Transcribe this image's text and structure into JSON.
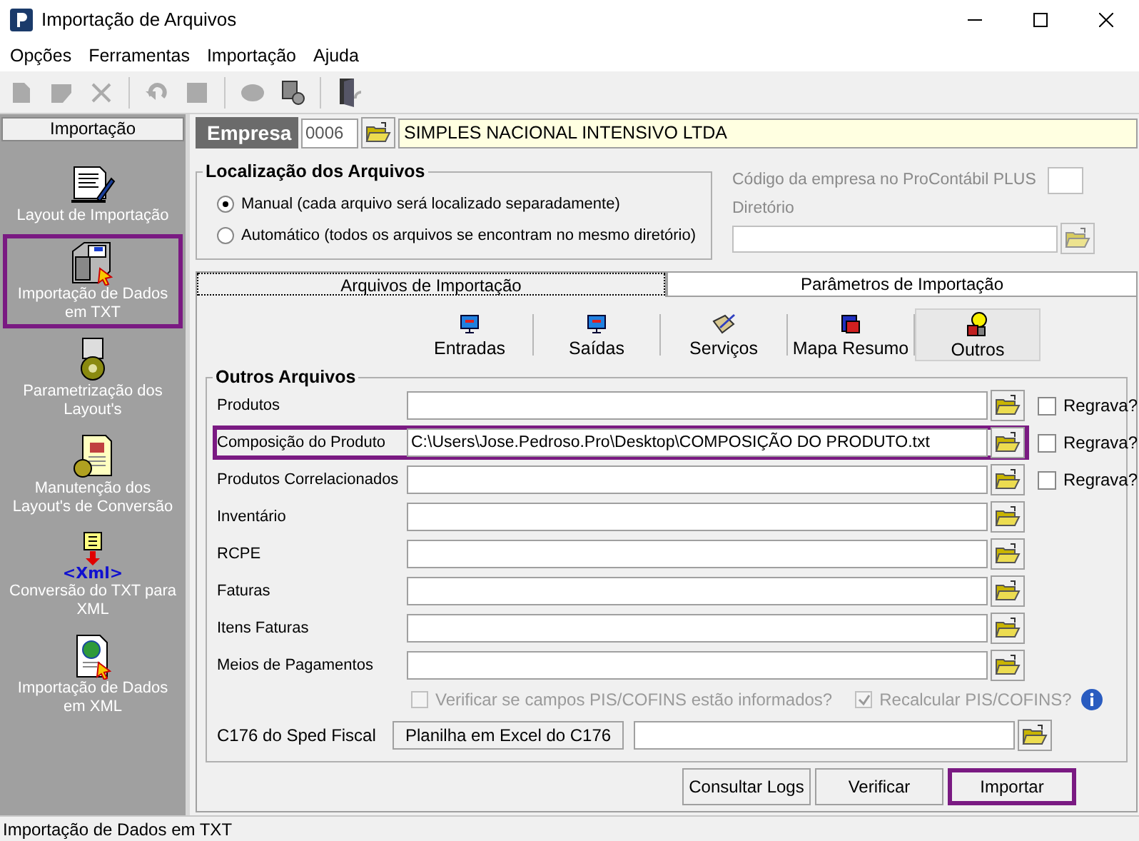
{
  "window": {
    "title": "Importação de Arquivos"
  },
  "menu": [
    "Opções",
    "Ferramentas",
    "Importação",
    "Ajuda"
  ],
  "sidebar": {
    "title": "Importação",
    "items": [
      {
        "label": "Layout de Importação",
        "highlighted": false
      },
      {
        "label": "Importação de Dados em TXT",
        "highlighted": true
      },
      {
        "label": "Parametrização dos Layout's",
        "highlighted": false
      },
      {
        "label": "Manutenção dos Layout's de Conversão",
        "highlighted": false
      },
      {
        "label": "Conversão do TXT para XML",
        "icon_text": "<Xml>",
        "highlighted": false
      },
      {
        "label": "Importação de Dados em XML",
        "highlighted": false
      }
    ]
  },
  "empresa": {
    "label": "Empresa",
    "code": "0006",
    "name": "SIMPLES NACIONAL INTENSIVO LTDA"
  },
  "localizacao": {
    "title": "Localização dos Arquivos",
    "options": [
      {
        "label": "Manual (cada arquivo será localizado separadamente)",
        "selected": true
      },
      {
        "label": "Automático (todos os arquivos se encontram no mesmo diretório)",
        "selected": false
      }
    ]
  },
  "procontabil": {
    "label": "Código da empresa no ProContábil PLUS",
    "directory_label": "Diretório"
  },
  "tabs": [
    {
      "label": "Arquivos de Importação",
      "selected": true
    },
    {
      "label": "Parâmetros de Importação",
      "selected": false
    }
  ],
  "categories": [
    {
      "label": "Entradas",
      "selected": false
    },
    {
      "label": "Saídas",
      "selected": false
    },
    {
      "label": "Serviços",
      "selected": false
    },
    {
      "label": "Mapa Resumo",
      "selected": false
    },
    {
      "label": "Outros",
      "selected": true
    }
  ],
  "group": {
    "title": "Outros Arquivos",
    "rows": [
      {
        "label": "Produtos",
        "regrava": {
          "label": "Regrava?",
          "checked": false
        },
        "highlighted": false
      },
      {
        "label": "Composição do Produto",
        "value": "C:\\Users\\Jose.Pedroso.Pro\\Desktop\\COMPOSIÇÃO DO PRODUTO.txt",
        "regrava": {
          "label": "Regrava?",
          "checked": false
        },
        "highlighted": true
      },
      {
        "label": "Produtos Correlacionados",
        "regrava": {
          "label": "Regrava?",
          "checked": false
        },
        "highlighted": false
      },
      {
        "label": "Inventário",
        "highlighted": false
      },
      {
        "label": "RCPE",
        "highlighted": false
      },
      {
        "label": "Faturas",
        "highlighted": false
      },
      {
        "label": "Itens Faturas",
        "highlighted": false
      },
      {
        "label": "Meios de Pagamentos",
        "highlighted": false
      }
    ],
    "options": [
      {
        "label": "Verificar se campos PIS/COFINS estão informados?",
        "checked": false,
        "disabled": true
      },
      {
        "label": "Recalcular PIS/COFINS?",
        "checked": true,
        "disabled": true
      }
    ],
    "c176": {
      "label": "C176 do Sped Fiscal",
      "button": "Planilha em Excel do C176"
    }
  },
  "buttons": [
    {
      "label": "Consultar Logs",
      "highlighted": false
    },
    {
      "label": "Verificar",
      "highlighted": false
    },
    {
      "label": "Importar",
      "highlighted": true
    }
  ],
  "status_bar": "Importação de Dados em TXT"
}
